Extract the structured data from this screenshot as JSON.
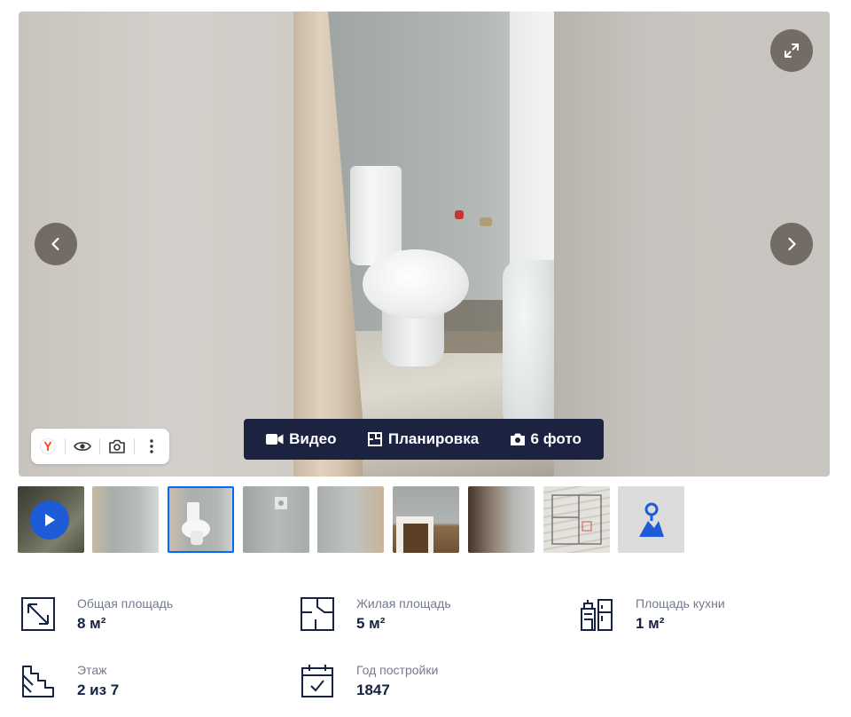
{
  "gallery": {
    "media_bar": {
      "video_label": "Видео",
      "plan_label": "Планировка",
      "photos_label": "6 фото"
    }
  },
  "features": [
    {
      "label": "Общая площадь",
      "value": "8 м²",
      "icon": "diagonal-arrow-area-icon"
    },
    {
      "label": "Жилая площадь",
      "value": "5 м²",
      "icon": "floor-plan-icon"
    },
    {
      "label": "Площадь кухни",
      "value": "1 м²",
      "icon": "kitchen-icon"
    },
    {
      "label": "Этаж",
      "value": "2 из 7",
      "icon": "stairs-icon"
    },
    {
      "label": "Год постройки",
      "value": "1847",
      "icon": "calendar-icon"
    }
  ],
  "colors": {
    "media_bar_bg": "#1b2340",
    "accent_blue": "#0468ff",
    "text_primary": "#152242",
    "text_secondary": "#737a8e"
  }
}
